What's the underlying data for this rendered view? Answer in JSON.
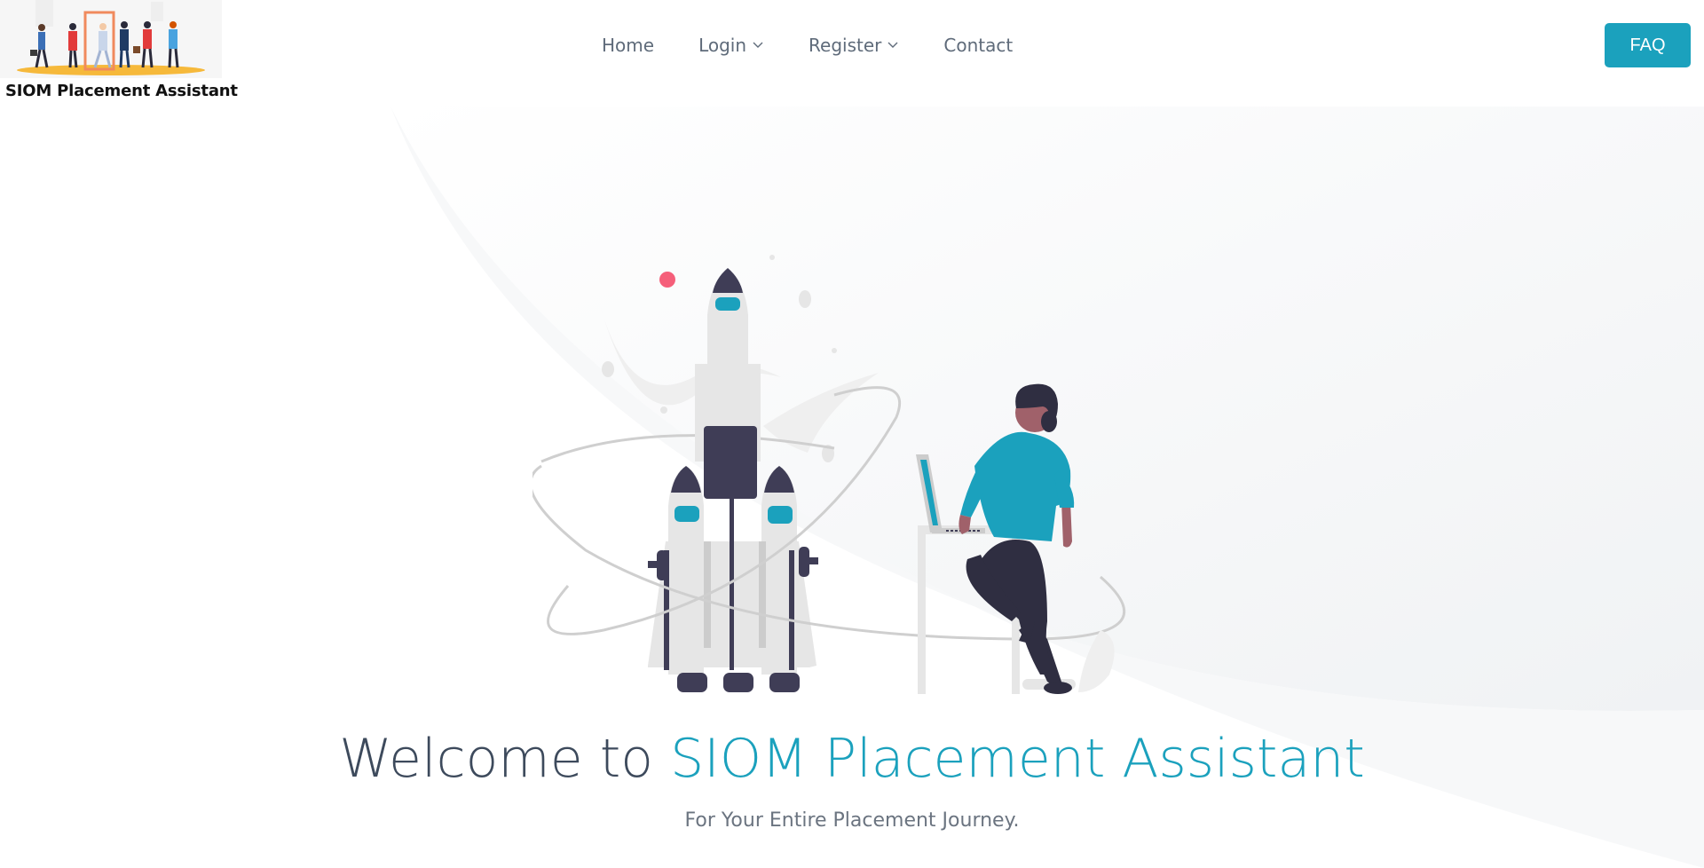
{
  "brand": {
    "name": "SIOM Placement Assistant"
  },
  "nav": {
    "items": [
      {
        "label": "Home"
      },
      {
        "label": "Login"
      },
      {
        "label": "Register"
      },
      {
        "label": "Contact"
      }
    ]
  },
  "header": {
    "faq_label": "FAQ"
  },
  "hero": {
    "title_prefix": "Welcome to ",
    "title_accent": "SIOM Placement Assistant",
    "subtitle": "For Your Entire Placement Journey."
  },
  "colors": {
    "accent": "#1ba1bd",
    "text_dark": "#3d4a5c",
    "nav_text": "#5f6b7a",
    "illustration_dark": "#3f3d56"
  },
  "icons": {
    "login_chevron": "chevron-down-icon",
    "register_chevron": "chevron-down-icon"
  }
}
